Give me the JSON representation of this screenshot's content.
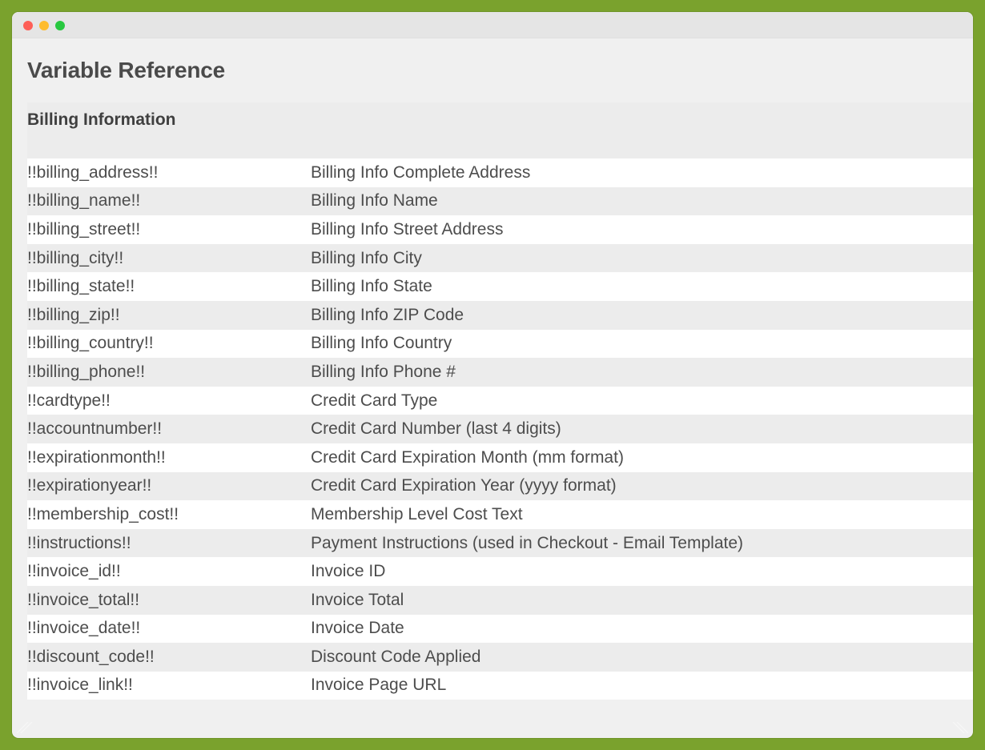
{
  "window": {
    "traffic_lights": [
      "close",
      "minimize",
      "zoom"
    ]
  },
  "page": {
    "title": "Variable Reference"
  },
  "section": {
    "title": "Billing Information"
  },
  "rows": [
    {
      "variable": "!!billing_address!!",
      "description": "Billing Info Complete Address"
    },
    {
      "variable": "!!billing_name!!",
      "description": "Billing Info Name"
    },
    {
      "variable": "!!billing_street!!",
      "description": "Billing Info Street Address"
    },
    {
      "variable": "!!billing_city!!",
      "description": "Billing Info City"
    },
    {
      "variable": "!!billing_state!!",
      "description": "Billing Info State"
    },
    {
      "variable": "!!billing_zip!!",
      "description": "Billing Info ZIP Code"
    },
    {
      "variable": "!!billing_country!!",
      "description": "Billing Info Country"
    },
    {
      "variable": "!!billing_phone!!",
      "description": "Billing Info Phone #"
    },
    {
      "variable": "!!cardtype!!",
      "description": "Credit Card Type"
    },
    {
      "variable": "!!accountnumber!!",
      "description": "Credit Card Number (last 4 digits)"
    },
    {
      "variable": "!!expirationmonth!!",
      "description": "Credit Card Expiration Month (mm format)"
    },
    {
      "variable": "!!expirationyear!!",
      "description": "Credit Card Expiration Year (yyyy format)"
    },
    {
      "variable": "!!membership_cost!!",
      "description": "Membership Level Cost Text"
    },
    {
      "variable": "!!instructions!!",
      "description": "Payment Instructions (used in Checkout - Email Template)"
    },
    {
      "variable": "!!invoice_id!!",
      "description": "Invoice ID"
    },
    {
      "variable": "!!invoice_total!!",
      "description": "Invoice Total"
    },
    {
      "variable": "!!invoice_date!!",
      "description": "Invoice Date"
    },
    {
      "variable": "!!discount_code!!",
      "description": "Discount Code Applied"
    },
    {
      "variable": "!!invoice_link!!",
      "description": "Invoice Page URL"
    }
  ],
  "colors": {
    "background": "#7aa22d",
    "window": "#f0f0f0",
    "titlebar": "#e5e5e5",
    "close": "#fe5f57",
    "minimize": "#febc2e",
    "zoom": "#28c840",
    "row_alt": "#ececec",
    "row": "#ffffff",
    "text": "#4d4d4d"
  }
}
